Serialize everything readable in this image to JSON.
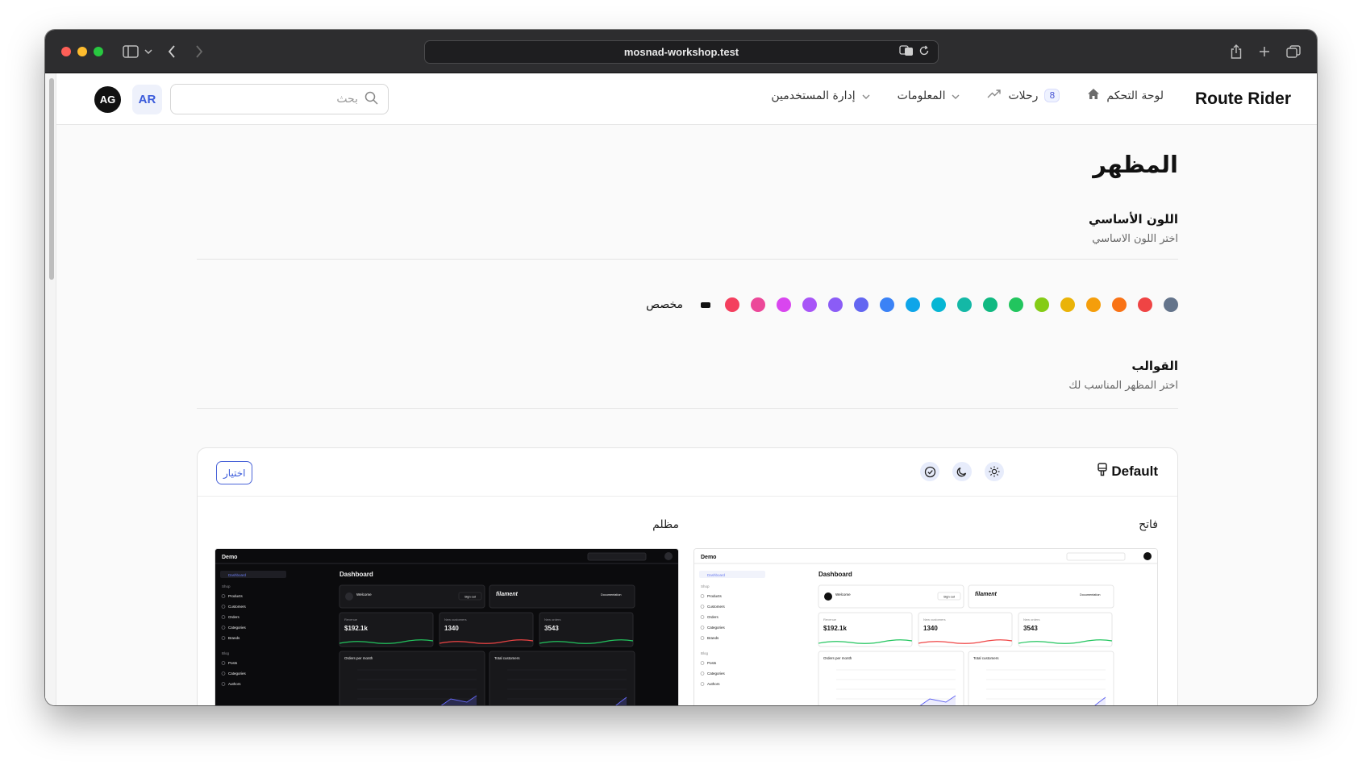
{
  "browser": {
    "url": "mosnad-workshop.test"
  },
  "app": {
    "brand": "Route Rider",
    "nav": [
      {
        "label": "لوحة التحكم",
        "icon": "home-icon"
      },
      {
        "label": "رحلات",
        "icon": "trending-icon",
        "badge": "8"
      },
      {
        "label": "المعلومات",
        "icon": "chevron-down-icon"
      },
      {
        "label": "إدارة المستخدمين",
        "icon": "chevron-down-icon"
      }
    ],
    "search_placeholder": "بحث",
    "language": "AR",
    "avatar_initials": "AG"
  },
  "page": {
    "title": "المظهر",
    "primary_color": {
      "title": "اللون الأساسي",
      "subtitle": "اختر اللون الاساسي",
      "swatches": [
        "#64748b",
        "#ef4444",
        "#f97316",
        "#f59e0b",
        "#eab308",
        "#84cc16",
        "#22c55e",
        "#10b981",
        "#14b8a6",
        "#06b6d4",
        "#0ea5e9",
        "#3b82f6",
        "#6366f1",
        "#8b5cf6",
        "#a855f7",
        "#d946ef",
        "#ec4899",
        "#f43f5e"
      ],
      "custom_label": "مخصص"
    },
    "themes": {
      "title": "القوالب",
      "subtitle": "اختر المظهر المناسب لك",
      "card": {
        "name": "Default",
        "select_label": "اختيار",
        "light_label": "فاتح",
        "dark_label": "مظلم"
      }
    }
  },
  "preview": {
    "app_name": "Demo",
    "heading": "Dashboard",
    "sidebar_active": "Dashboard",
    "welcome": "Welcome",
    "brand": "filament",
    "signout": "Sign out",
    "docs": "Documentation",
    "stats": [
      {
        "label": "Revenue",
        "value": "$192.1k"
      },
      {
        "label": "New customers",
        "value": "1340"
      },
      {
        "label": "New orders",
        "value": "3543"
      }
    ],
    "chart1": "Orders per month",
    "chart2": "Total customers",
    "sidebar_groups": [
      {
        "title": "Shop",
        "items": [
          "Products",
          "Customers",
          "Orders",
          "Categories",
          "Brands"
        ]
      },
      {
        "title": "Blog",
        "items": [
          "Posts",
          "Categories",
          "Authors"
        ]
      }
    ]
  }
}
